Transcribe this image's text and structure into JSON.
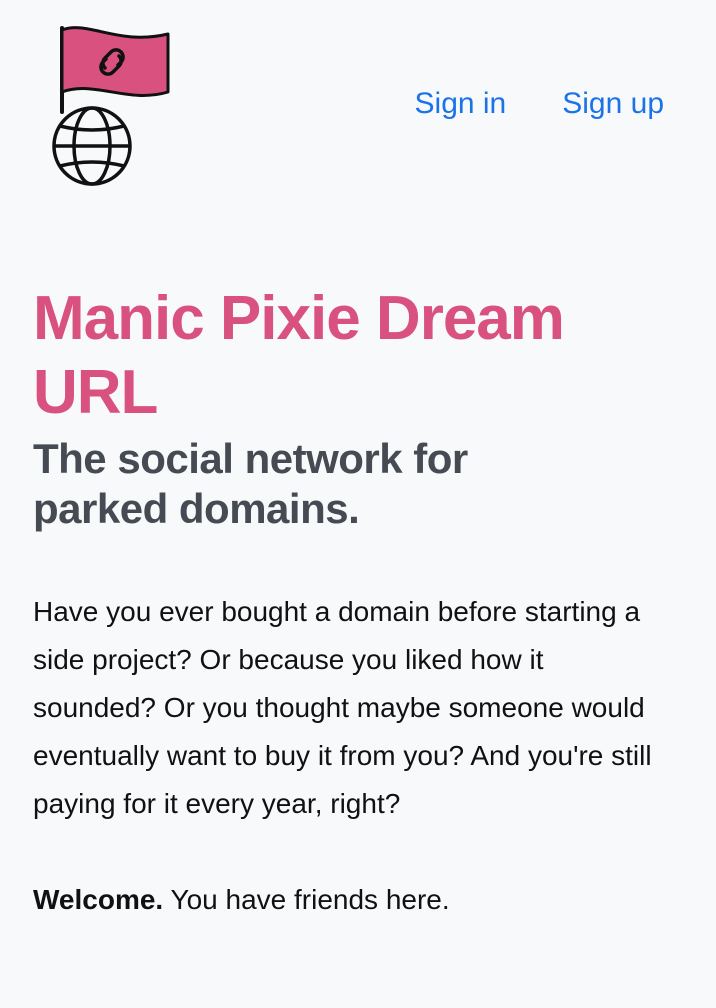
{
  "header": {
    "logo_icon": "flag-globe-link-icon",
    "nav": {
      "signin_label": "Sign in",
      "signup_label": "Sign up"
    }
  },
  "hero": {
    "title": "Manic Pixie Dream URL",
    "subtitle": "The social network for parked domains.",
    "intro": "Have you ever bought a domain before starting a side project? Or because you liked how it sounded? Or you thought maybe someone would eventually want to buy it from you? And you're still paying for it every year, right?",
    "welcome_bold": "Welcome.",
    "welcome_text": " You have friends here."
  },
  "colors": {
    "background": "#f8f9fb",
    "accent_pink": "#d9527f",
    "subtitle_gray": "#464b53",
    "link_blue": "#1a73e8"
  }
}
